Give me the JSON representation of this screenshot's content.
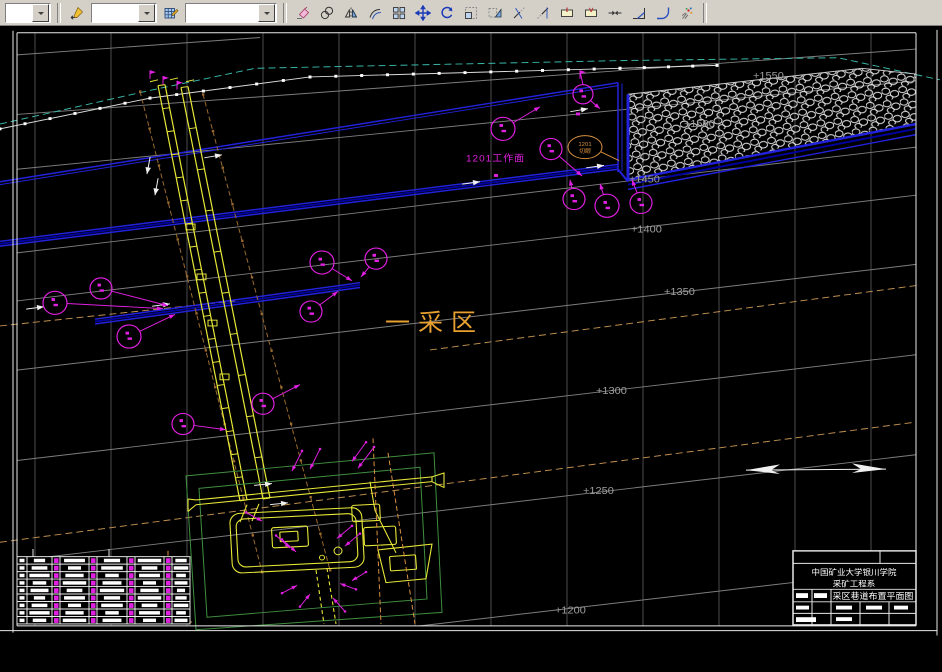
{
  "toolbar": {
    "combos": [
      {
        "name": "quick-select-combo",
        "value": ""
      },
      {
        "name": "layer-combo",
        "value": ""
      },
      {
        "name": "color-combo",
        "value": ""
      }
    ],
    "buttons": [
      {
        "name": "make-object-layer-current"
      },
      {
        "name": "layer-properties"
      },
      {
        "name": "erase"
      },
      {
        "name": "copy"
      },
      {
        "name": "mirror"
      },
      {
        "name": "offset"
      },
      {
        "name": "array"
      },
      {
        "name": "move"
      },
      {
        "name": "rotate"
      },
      {
        "name": "scale"
      },
      {
        "name": "stretch"
      },
      {
        "name": "trim"
      },
      {
        "name": "extend"
      },
      {
        "name": "break-at-point"
      },
      {
        "name": "break"
      },
      {
        "name": "join"
      },
      {
        "name": "chamfer"
      },
      {
        "name": "fillet"
      },
      {
        "name": "explode"
      }
    ]
  },
  "drawing": {
    "colors": {
      "magenta": "#e020e0",
      "yellow": "#e8e838",
      "green": "#3f8f3f",
      "blue": "#2222dd",
      "darkblue": "#0000a0",
      "cyan": "#38b8a8",
      "tan": "#c09050",
      "brown": "#9a6a30",
      "orange": "#d89040",
      "grid": "#4d4d4d",
      "contour": "#7d7d7d",
      "label": "#9f9f9f",
      "white": "#e8e8e8",
      "area_label": "#e8a030"
    },
    "contour_labels": [
      "+1550",
      "+1500",
      "+1450",
      "+1400",
      "+1350",
      "+1300",
      "+1250",
      "+1200"
    ],
    "area_label": "一采区",
    "face_label": "1201工作面",
    "cut_callout": {
      "line1": "1201",
      "line2": "切眼"
    },
    "title_block": {
      "school": "中国矿业大学银川学院",
      "department": "采矿工程系",
      "drawing_title": "采区巷道布置平面图"
    }
  }
}
